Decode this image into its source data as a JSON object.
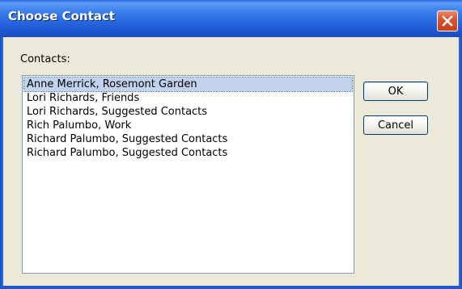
{
  "window": {
    "title": "Choose Contact",
    "close_icon": "close-icon"
  },
  "contacts": {
    "label": "Contacts:",
    "items": [
      "Anne Merrick, Rosemont Garden",
      "Lori Richards, Friends",
      "Lori Richards, Suggested Contacts",
      "Rich Palumbo, Work",
      "Richard Palumbo, Suggested Contacts",
      "Richard Palumbo, Suggested Contacts"
    ],
    "selected_index": 0
  },
  "buttons": {
    "ok_label": "OK",
    "cancel_label": "Cancel"
  },
  "colors": {
    "titlebar": "#2766E0",
    "face": "#ECE9D8",
    "selection": "#C1D2EE",
    "close_button": "#D9542F"
  }
}
